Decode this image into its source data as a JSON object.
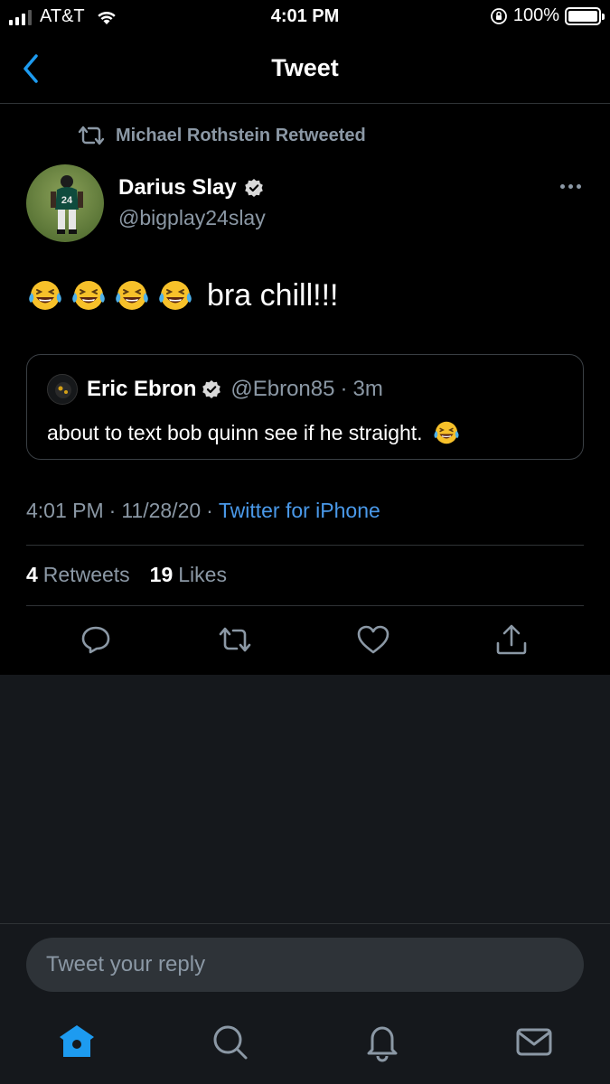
{
  "status_bar": {
    "carrier": "AT&T",
    "time": "4:01 PM",
    "battery": "100%"
  },
  "nav": {
    "title": "Tweet"
  },
  "retweet_context": {
    "text": "Michael Rothstein Retweeted"
  },
  "author": {
    "name": "Darius Slay",
    "handle": "@bigplay24slay"
  },
  "tweet": {
    "text": "bra chill!!!",
    "emoji_count": 4
  },
  "quoted_tweet": {
    "name": "Eric Ebron",
    "handle": "@Ebron85",
    "time": "3m",
    "text": "about to text bob quinn see if he straight."
  },
  "meta": {
    "time": "4:01 PM",
    "date": "11/28/20",
    "source": "Twitter for iPhone"
  },
  "stats": {
    "retweets_count": "4",
    "retweets_label": "Retweets",
    "likes_count": "19",
    "likes_label": "Likes"
  },
  "reply": {
    "placeholder": "Tweet your reply"
  },
  "colors": {
    "accent": "#1d9bf0",
    "link": "#4a99e9",
    "muted": "#8b98a5",
    "background": "#000000"
  },
  "icons": [
    "back-chevron-icon",
    "retweet-icon",
    "verified-icon",
    "more-icon",
    "reply-icon",
    "share-icon",
    "heart-icon",
    "home-icon",
    "search-icon",
    "bell-icon",
    "mail-icon"
  ]
}
